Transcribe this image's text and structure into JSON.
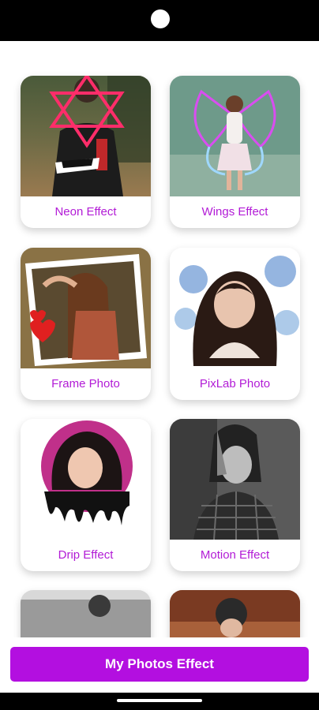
{
  "effects": [
    {
      "label": "Neon Effect"
    },
    {
      "label": "Wings Effect"
    },
    {
      "label": "Frame Photo"
    },
    {
      "label": "PixLab Photo"
    },
    {
      "label": "Drip Effect"
    },
    {
      "label": "Motion Effect"
    }
  ],
  "cta": {
    "label": "My Photos Effect"
  },
  "colors": {
    "accent": "#b30fe0",
    "label": "#b21bd6",
    "status_bar": "#000000"
  },
  "icons": {
    "camera": "camera-dot-icon",
    "home": "home-indicator-icon"
  }
}
